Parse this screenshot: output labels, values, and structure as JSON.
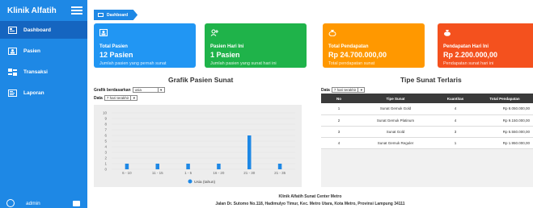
{
  "app": {
    "brand": "Klinik Alfatih"
  },
  "sidebar": {
    "items": [
      {
        "label": "Dashboard",
        "icon": "dashboard-icon"
      },
      {
        "label": "Pasien",
        "icon": "users-icon"
      },
      {
        "label": "Transaksi",
        "icon": "transaction-icon"
      },
      {
        "label": "Laporan",
        "icon": "report-icon"
      }
    ],
    "user": "admin"
  },
  "breadcrumb": "Dashboard",
  "cards": [
    {
      "title": "Total Pasien",
      "value": "12 Pasien",
      "desc": "Jumlah pasien yang pernah sunat",
      "color": "#2196f3"
    },
    {
      "title": "Pasien Hari Ini",
      "value": "1 Pasien",
      "desc": "Jumlah pasien yang sunat hari ini",
      "color": "#1fb34a"
    },
    {
      "title": "Total Pendapatan",
      "value": "Rp 24.700.000,00",
      "desc": "Total pendapatan sunat",
      "color": "#ff9800"
    },
    {
      "title": "Pendapatan Hari Ini",
      "value": "Rp 2.200.000,00",
      "desc": "Pendapatan sunat hari ini",
      "color": "#f4511e"
    }
  ],
  "grafik": {
    "title": "Grafik Pasien Sunat",
    "group_label": "Grafik berdasarkan",
    "group_value": "usia",
    "date_label": "Data",
    "date_value": "7 hari terakhir"
  },
  "tipe": {
    "title": "Tipe Sunat Terlaris",
    "date_label": "Data",
    "date_value": "7 hari terakhir",
    "columns": [
      "No",
      "Tipe Sunat",
      "Kuantitas",
      "Total Pendapatan"
    ],
    "rows": [
      [
        "1",
        "Sunat Gemuk Gold",
        "4",
        "Rp 8.050.000,00"
      ],
      [
        "2",
        "Sunat Gemuk Platinum",
        "4",
        "Rp 9.150.000,00"
      ],
      [
        "3",
        "Sunat Gold",
        "3",
        "Rp 5.550.000,00"
      ],
      [
        "4",
        "Sunat Gemuk Reguler",
        "1",
        "Rp 1.950.000,00"
      ]
    ]
  },
  "chart_data": {
    "type": "bar",
    "categories": [
      "6 - 10",
      "11 - 15",
      "1 - 5",
      "16 - 20",
      "21 - 30",
      "21 - 35"
    ],
    "values": [
      1,
      1,
      1,
      1,
      6,
      1
    ],
    "ylim": [
      0,
      10
    ],
    "yticks": [
      0,
      1,
      2,
      3,
      4,
      5,
      6,
      7,
      8,
      9,
      10
    ],
    "series_name": "Usia (tahun)",
    "bar_color": "#1e88e5",
    "grid": true,
    "legend": "bottom-center"
  },
  "footer": {
    "line1": "Klinik Alfatih Sunat Center Metro",
    "line2": "Jalan Dr. Sutomo No.118, Hadimulyo Timur, Kec. Metro Utara, Kota Metro, Provinsi Lampung 34111"
  }
}
